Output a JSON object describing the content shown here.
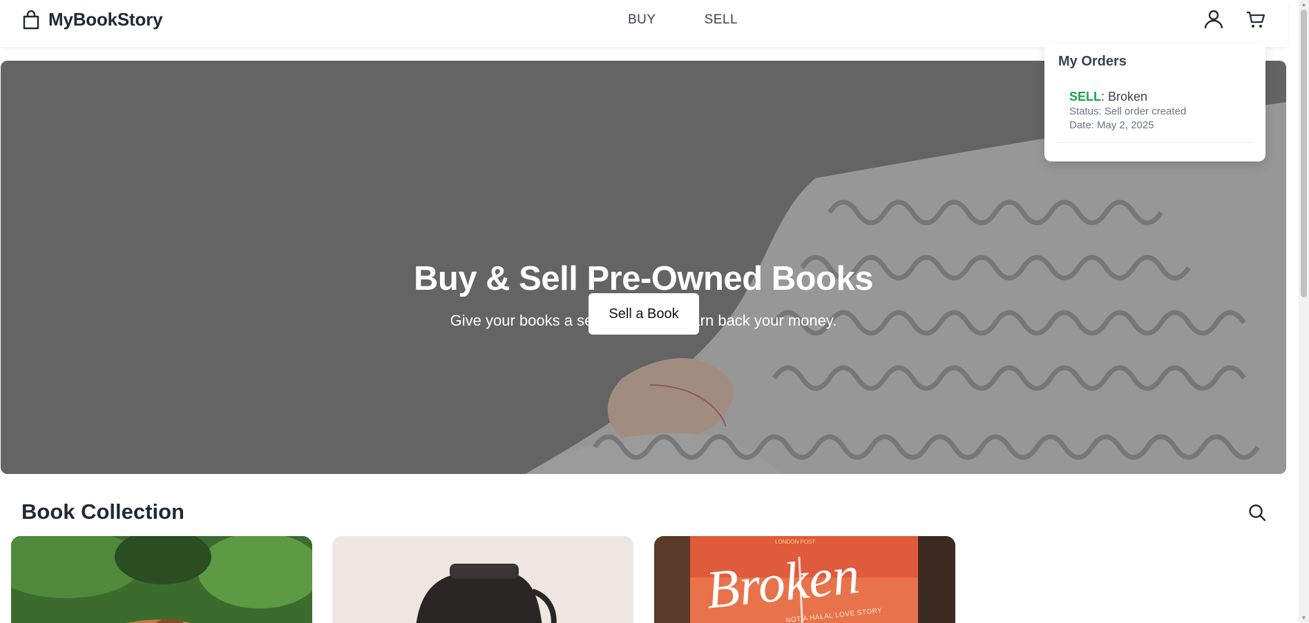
{
  "brand": {
    "name": "MyBookStory",
    "icon": "shopping-bag-icon"
  },
  "nav": {
    "buy": "BUY",
    "sell": "SELL"
  },
  "header_icons": {
    "user": "user-icon",
    "cart": "cart-icon"
  },
  "hero": {
    "title": "Buy & Sell Pre-Owned Books",
    "subtitle": "Give your books a second life and earn back your money.",
    "cta": "Sell a Book"
  },
  "orders": {
    "title": "My Orders",
    "items": [
      {
        "type": "SELL",
        "book": ": Broken",
        "status": "Status: Sell order created",
        "date": "Date: May 2, 2025"
      }
    ]
  },
  "collection": {
    "title": "Book Collection",
    "search_icon": "search-icon",
    "cards": [
      {
        "name": "book-card-plant"
      },
      {
        "name": "book-card-bag"
      },
      {
        "name": "book-card-broken",
        "cover_top": "LONDON POST",
        "cover_title": "Broken",
        "cover_tagline": "NOT A HALAL LOVE STORY"
      }
    ]
  },
  "colors": {
    "accent_sell": "#16a34a",
    "text_dark": "#1f2937",
    "hero_overlay": "#6f6f6f"
  }
}
